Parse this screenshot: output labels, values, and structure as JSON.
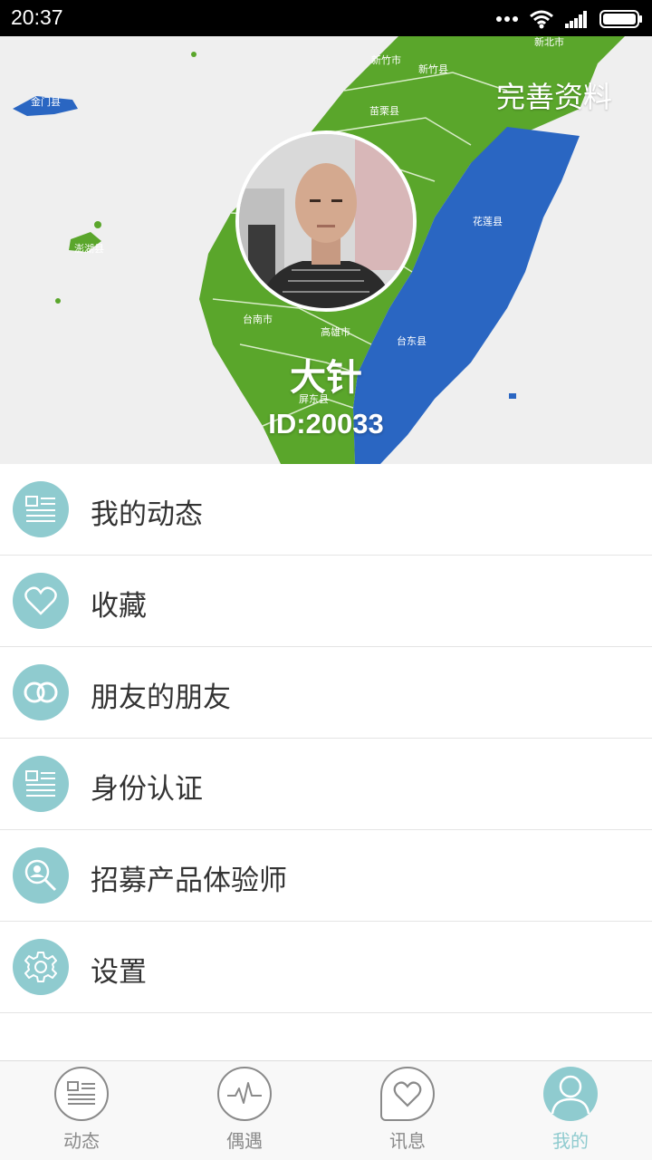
{
  "status_bar": {
    "time": "20:37",
    "icons": [
      "more-dots-icon",
      "wifi-icon",
      "signal-icon",
      "battery-icon"
    ]
  },
  "profile": {
    "edit_label": "完善资料",
    "nickname": "大针",
    "id_text": "ID:20033",
    "background_map_labels": [
      "新北市",
      "新竹市",
      "新竹县",
      "苗栗县",
      "金门县",
      "澎湖县",
      "花莲县",
      "台南市",
      "高雄市",
      "台东县",
      "屏东县"
    ]
  },
  "menu": {
    "items": [
      {
        "label": "我的动态",
        "icon": "news-list-icon"
      },
      {
        "label": "收藏",
        "icon": "heart-icon"
      },
      {
        "label": "朋友的朋友",
        "icon": "rings-icon"
      },
      {
        "label": "身份认证",
        "icon": "id-card-icon"
      },
      {
        "label": "招募产品体验师",
        "icon": "user-search-icon"
      },
      {
        "label": "设置",
        "icon": "gear-icon"
      }
    ]
  },
  "tabbar": {
    "tabs": [
      {
        "label": "动态",
        "icon": "news-list-icon",
        "active": false
      },
      {
        "label": "偶遇",
        "icon": "pulse-icon",
        "active": false
      },
      {
        "label": "讯息",
        "icon": "chat-heart-icon",
        "active": false
      },
      {
        "label": "我的",
        "icon": "user-icon",
        "active": true
      }
    ]
  },
  "colors": {
    "accent": "#8fcbcf",
    "map_green": "#5aa62b",
    "map_blue": "#2a66c2",
    "text": "#333333",
    "tab_inactive": "#8a8a8a"
  }
}
